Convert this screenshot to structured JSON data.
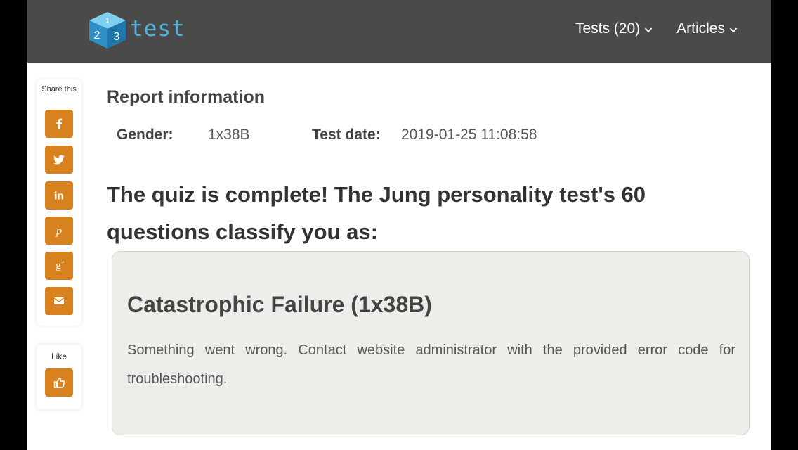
{
  "header": {
    "logo_text": "test",
    "logo_cube_digits": [
      "2",
      "3",
      "1"
    ],
    "nav": [
      {
        "label": "Tests (20)",
        "icon": "chevron-down-icon"
      },
      {
        "label": "Articles",
        "icon": "chevron-down-icon"
      }
    ]
  },
  "share": {
    "title": "Share this",
    "buttons": [
      {
        "name": "facebook",
        "icon": "facebook-icon"
      },
      {
        "name": "twitter",
        "icon": "twitter-icon"
      },
      {
        "name": "linkedin",
        "icon": "linkedin-icon"
      },
      {
        "name": "pinterest",
        "icon": "pinterest-icon"
      },
      {
        "name": "google-plus",
        "icon": "google-plus-icon"
      },
      {
        "name": "email",
        "icon": "email-icon"
      }
    ],
    "like_title": "Like",
    "like_icon": "thumbs-up-icon"
  },
  "report": {
    "heading": "Report information",
    "gender_label": "Gender:",
    "gender_value": "1x38B",
    "date_label": "Test date:",
    "date_value": "2019-01-25 11:08:58"
  },
  "result": {
    "heading": "The quiz is complete! The Jung personality test's 60 questions classify you as:",
    "card_title": "Catastrophic Failure (1x38B)",
    "card_text": "Something went wrong. Contact website administrator with the provided error code for troubleshooting."
  },
  "colors": {
    "topbar": "#4a4a4a",
    "accent_orange": "#d8821f",
    "logo_blue": "#4fb3d9",
    "card_bg": "#efedea"
  }
}
